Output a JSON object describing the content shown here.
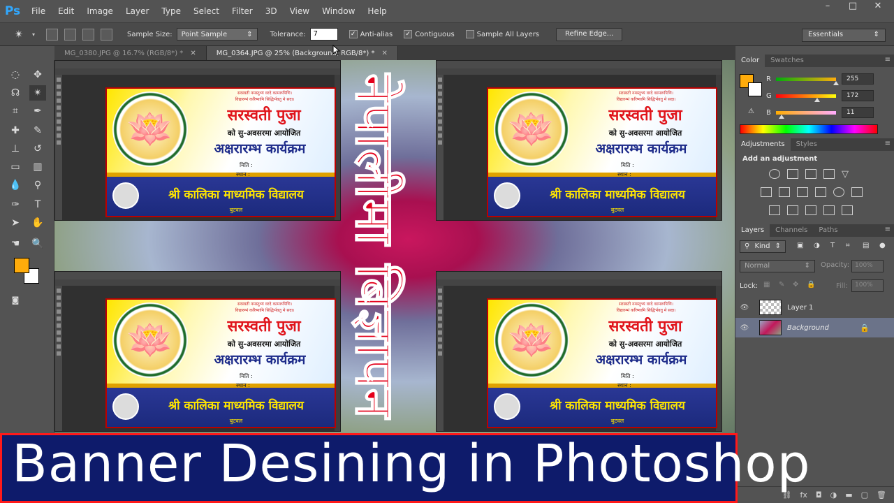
{
  "app": {
    "logo": "Ps"
  },
  "menu": [
    "File",
    "Edit",
    "Image",
    "Layer",
    "Type",
    "Select",
    "Filter",
    "3D",
    "View",
    "Window",
    "Help"
  ],
  "window_controls": {
    "minimize": "–",
    "restore": "□",
    "close": "✕"
  },
  "options": {
    "sample_size_label": "Sample Size:",
    "sample_size_value": "Point Sample",
    "tolerance_label": "Tolerance:",
    "tolerance_value": "7",
    "anti_alias": "Anti-alias",
    "contiguous": "Contiguous",
    "sample_all_layers": "Sample All Layers",
    "refine_edge": "Refine Edge...",
    "workspace": "Essentials"
  },
  "tabs": [
    {
      "label": "MG_0380.JPG @ 16.7% (RGB/8*) *",
      "active": false
    },
    {
      "label": "MG_0364.JPG @ 25% (Background, RGB/8*) *",
      "active": true
    }
  ],
  "banner": {
    "verse_1": "सरस्वती नमस्तुभ्यं वरदे कामरूपिणि।",
    "verse_2": "विद्यारम्भं करिष्यामि सिद्धिर्भवतु मे सदा।",
    "title": "सरस्वती पुजा",
    "subtitle": "को सु-अवसरमा आयोजित",
    "program": "अक्षरारम्भ कार्यक्रम",
    "date_label": "मिति :",
    "place_label": "स्थान :",
    "school": "श्री कालिका माध्यमिक विद्यालय",
    "city": "बुटवल"
  },
  "vertical_text": "नेपालीमा बिज्ञापन",
  "color_panel": {
    "tabs": [
      "Color",
      "Swatches"
    ],
    "r_label": "R",
    "g_label": "G",
    "b_label": "B",
    "r": "255",
    "g": "172",
    "b": "11",
    "r_level": 1.0,
    "g_level": 0.675,
    "b_level": 0.043,
    "foreground": "#ffac0b"
  },
  "adjustments": {
    "tabs": [
      "Adjustments",
      "Styles"
    ],
    "title": "Add an adjustment"
  },
  "layers": {
    "tabs": [
      "Layers",
      "Channels",
      "Paths"
    ],
    "kind_label": "Kind",
    "blend_mode": "Normal",
    "opacity_label": "Opacity:",
    "opacity_value": "100%",
    "lock_label": "Lock:",
    "fill_label": "Fill:",
    "fill_value": "100%",
    "items": [
      {
        "name": "Layer 1",
        "selected": false
      },
      {
        "name": "Background",
        "selected": true
      }
    ]
  },
  "caption": "Banner Desining in Photoshop",
  "colors": {
    "caption_bg": "#0e1b6b",
    "caption_border": "#ff1a1a",
    "accent_red": "#e4001b",
    "banner_blue": "#1d2b8a"
  }
}
